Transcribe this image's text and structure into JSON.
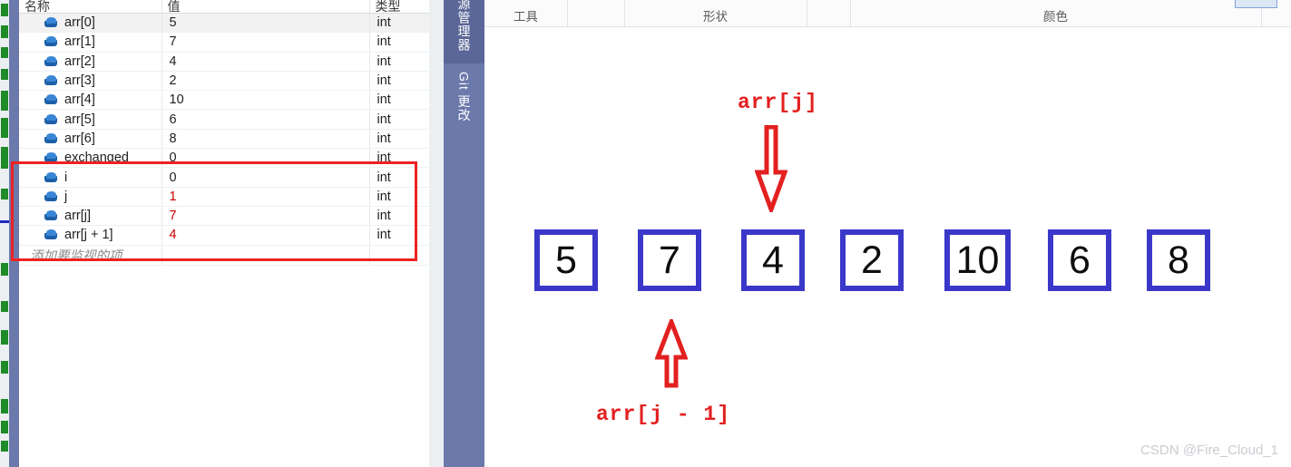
{
  "watch_panel": {
    "columns": [
      "名称",
      "值",
      "类型"
    ],
    "rows": [
      {
        "name": "arr[0]",
        "value": "5",
        "type": "int",
        "changed": false,
        "highlighted": false
      },
      {
        "name": "arr[1]",
        "value": "7",
        "type": "int",
        "changed": false,
        "highlighted": false
      },
      {
        "name": "arr[2]",
        "value": "4",
        "type": "int",
        "changed": false,
        "highlighted": false
      },
      {
        "name": "arr[3]",
        "value": "2",
        "type": "int",
        "changed": false,
        "highlighted": false
      },
      {
        "name": "arr[4]",
        "value": "10",
        "type": "int",
        "changed": false,
        "highlighted": false
      },
      {
        "name": "arr[5]",
        "value": "6",
        "type": "int",
        "changed": false,
        "highlighted": false
      },
      {
        "name": "arr[6]",
        "value": "8",
        "type": "int",
        "changed": false,
        "highlighted": false
      },
      {
        "name": "exchanged",
        "value": "0",
        "type": "int",
        "changed": false,
        "highlighted": false
      },
      {
        "name": "i",
        "value": "0",
        "type": "int",
        "changed": false,
        "highlighted": true
      },
      {
        "name": "j",
        "value": "1",
        "type": "int",
        "changed": true,
        "highlighted": true
      },
      {
        "name": "arr[j]",
        "value": "7",
        "type": "int",
        "changed": true,
        "highlighted": true
      },
      {
        "name": "arr[j + 1]",
        "value": "4",
        "type": "int",
        "changed": true,
        "highlighted": true
      }
    ],
    "add_placeholder": "添加要监视的项",
    "highlight_color": "#ee2222",
    "changed_value_color": "#cc0000",
    "row_icon": "field-cube-icon"
  },
  "side_tabs": {
    "items": [
      {
        "label": "源管理器"
      },
      {
        "label": "Git 更改"
      }
    ],
    "background_color": "#6b79ab"
  },
  "ribbon": {
    "groups": [
      {
        "label": "工具"
      },
      {
        "label": ""
      },
      {
        "label": "形状"
      },
      {
        "label": ""
      },
      {
        "label": "颜色"
      },
      {
        "label": ""
      }
    ],
    "selected_swatch": "selected-color-swatch"
  },
  "diagram": {
    "array_values": [
      "5",
      "7",
      "4",
      "2",
      "10",
      "6",
      "8"
    ],
    "box_border_color": "#3b38c9",
    "annotation_color": "#e32020",
    "top_label": "arr[j]",
    "top_arrow": "down-arrow-icon",
    "bottom_label": "arr[j - 1]",
    "bottom_arrow": "up-arrow-icon",
    "top_arrow_target_index": 2,
    "bottom_arrow_target_index": 1
  },
  "watermark": {
    "text": "CSDN @Fire_Cloud_1"
  }
}
